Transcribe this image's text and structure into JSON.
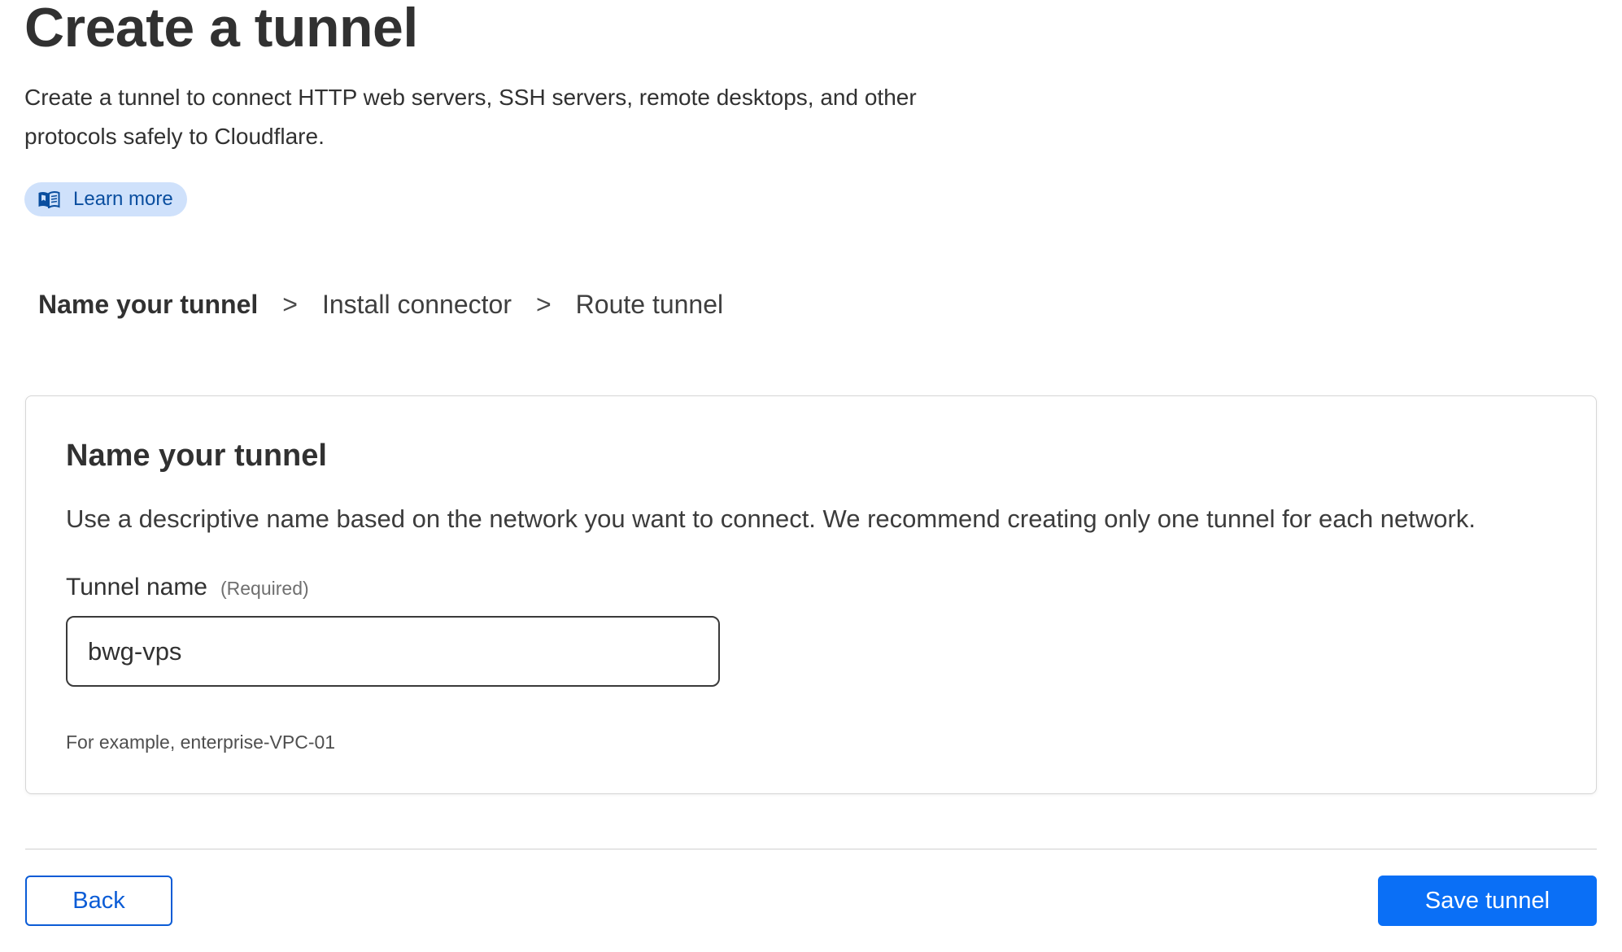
{
  "page": {
    "title": "Create a tunnel",
    "description": "Create a tunnel to connect HTTP web servers, SSH servers, remote desktops, and other protocols safely to Cloudflare.",
    "learn_more": {
      "label": "Learn more",
      "icon": "book-icon"
    }
  },
  "steps": [
    {
      "label": "Name your tunnel",
      "active": true
    },
    {
      "label": "Install connector",
      "active": false
    },
    {
      "label": "Route tunnel",
      "active": false
    }
  ],
  "step_separator": ">",
  "card": {
    "title": "Name your tunnel",
    "description": "Use a descriptive name based on the network you want to connect. We recommend creating only one tunnel for each network.",
    "field": {
      "label": "Tunnel name",
      "required_label": "(Required)",
      "value": "bwg-vps",
      "help": "For example, enterprise-VPC-01"
    }
  },
  "footer": {
    "back_label": "Back",
    "save_label": "Save tunnel"
  },
  "colors": {
    "accent": "#0a6ff6",
    "outline_button": "#0b5cd6",
    "learn_more_bg": "#cfe1fb",
    "learn_more_text": "#0a4e9f",
    "text": "#313131"
  }
}
